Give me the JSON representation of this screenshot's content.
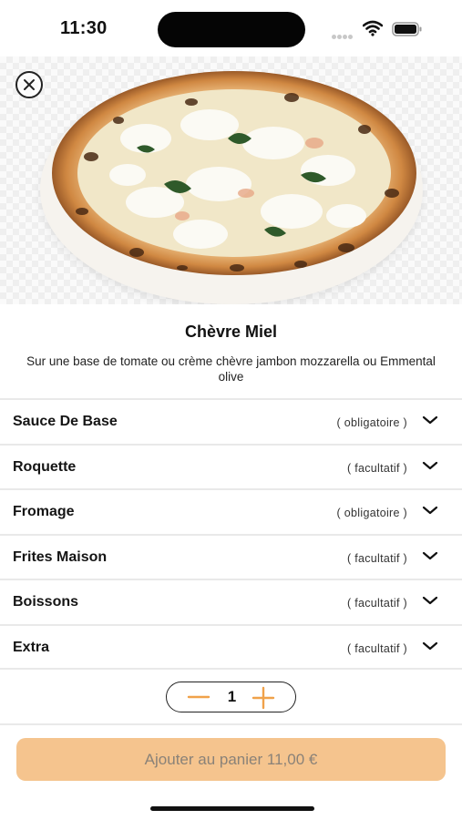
{
  "status_bar": {
    "time": "11:30"
  },
  "product": {
    "title": "Chèvre Miel",
    "description": "Sur une base de tomate ou crème chèvre jambon mozzarella ou Emmental olive"
  },
  "options": [
    {
      "name": "Sauce De Base",
      "tag": "( obligatoire )"
    },
    {
      "name": "Roquette",
      "tag": "( facultatif )"
    },
    {
      "name": "Fromage",
      "tag": "( obligatoire )"
    },
    {
      "name": "Frites Maison",
      "tag": "( facultatif )"
    },
    {
      "name": "Boissons",
      "tag": "( facultatif )"
    },
    {
      "name": "Extra",
      "tag": "( facultatif )"
    }
  ],
  "quantity": {
    "value": "1"
  },
  "cart": {
    "label": "Ajouter au panier 11,00 €"
  },
  "colors": {
    "accent": "#f0a24a",
    "button_bg": "#f5c48e",
    "button_text": "#8a8278"
  }
}
